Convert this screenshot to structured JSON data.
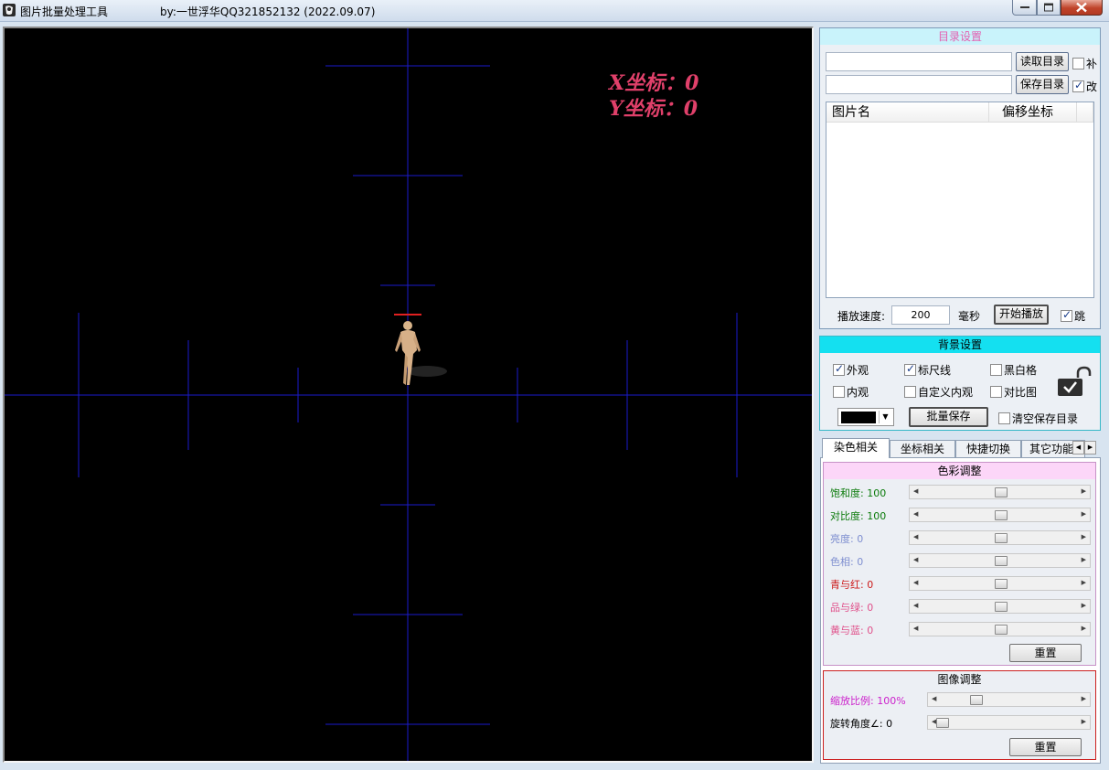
{
  "window": {
    "title": "图片批量处理工具",
    "author": "by:一世浮华QQ321852132  (2022.09.07)"
  },
  "canvas": {
    "x_label": "X坐标：0",
    "y_label": "Y坐标：0",
    "background": "#000000",
    "grid_color": "#1a1acc",
    "marker_color": "#e02020"
  },
  "directory": {
    "title": "目录设置",
    "read_button": "读取目录",
    "save_button": "保存目录",
    "read_path": "",
    "save_path": "",
    "check_bu": {
      "label": "补",
      "checked": false
    },
    "check_gai": {
      "label": "改",
      "checked": true
    },
    "columns": [
      "图片名",
      "偏移坐标"
    ],
    "speed_label": "播放速度:",
    "speed_value": "200",
    "speed_unit": "毫秒",
    "play_button": "开始播放",
    "check_tiao": {
      "label": "跳",
      "checked": true
    }
  },
  "background": {
    "title": "背景设置",
    "options": [
      {
        "label": "外观",
        "checked": true
      },
      {
        "label": "标尺线",
        "checked": true
      },
      {
        "label": "黑白格",
        "checked": false
      },
      {
        "label": "内观",
        "checked": false
      },
      {
        "label": "自定义内观",
        "checked": false
      },
      {
        "label": "对比图",
        "checked": false
      }
    ],
    "color_value": "#000000",
    "batch_save_button": "批量保存",
    "clear_dir": {
      "label": "清空保存目录",
      "checked": false
    }
  },
  "tabs": [
    {
      "label": "染色相关",
      "active": true
    },
    {
      "label": "坐标相关",
      "active": false
    },
    {
      "label": "快捷切换",
      "active": false
    },
    {
      "label": "其它功能",
      "active": false
    }
  ],
  "color_adjust": {
    "title": "色彩调整",
    "sliders": [
      {
        "label": "饱和度: 100",
        "color": "#0a7a0a",
        "level": 0.5
      },
      {
        "label": "对比度: 100",
        "color": "#0a7a0a",
        "level": 0.5
      },
      {
        "label": "亮度: 0",
        "color": "#7f8fd0",
        "level": 0.5
      },
      {
        "label": "色相: 0",
        "color": "#7f8fd0",
        "level": 0.5
      },
      {
        "label": "青与红: 0",
        "color": "#cc1a1a",
        "level": 0.5
      },
      {
        "label": "品与绿: 0",
        "color": "#e0508a",
        "level": 0.5
      },
      {
        "label": "黄与蓝: 0",
        "color": "#e0508a",
        "level": 0.5
      }
    ],
    "reset_button": "重置"
  },
  "image_adjust": {
    "title": "图像调整",
    "sliders": [
      {
        "label": "缩放比例: 100%",
        "color": "#cc22cc",
        "level": 0.25
      },
      {
        "label": "旋转角度∠: 0",
        "color": "#000000",
        "level": 0.0
      }
    ],
    "reset_button": "重置"
  }
}
